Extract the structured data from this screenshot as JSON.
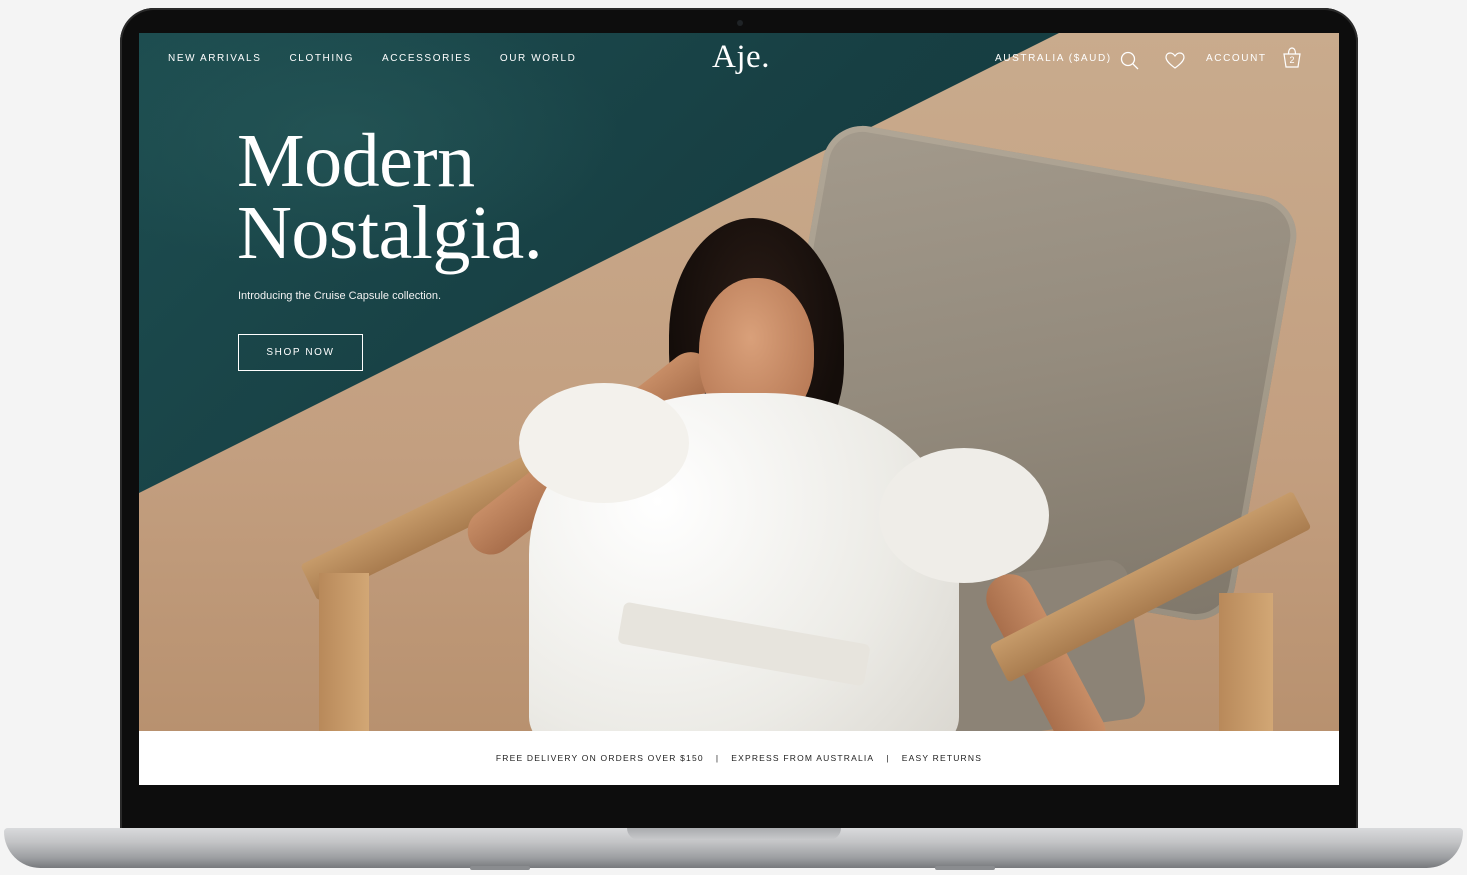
{
  "nav": {
    "links": [
      "NEW ARRIVALS",
      "CLOTHING",
      "ACCESSORIES",
      "OUR WORLD"
    ],
    "logo": "Aje.",
    "region": "AUSTRALIA ($AUD)",
    "account": "ACCOUNT",
    "cart_count": "2",
    "icons": [
      "search-icon",
      "heart-icon",
      "shopping-bag-icon"
    ]
  },
  "hero": {
    "headline_line1": "Modern",
    "headline_line2": "Nostalgia.",
    "subline": "Introducing the Cruise Capsule collection.",
    "cta": "SHOP NOW"
  },
  "benefits": [
    "FREE DELIVERY ON ORDERS OVER $150",
    "EXPRESS FROM AUSTRALIA",
    "EASY RETURNS"
  ],
  "colors": {
    "pool_teal": "#173f43",
    "sand": "#c39f80",
    "text_light": "#ffffff",
    "benefits_text": "#222222"
  }
}
